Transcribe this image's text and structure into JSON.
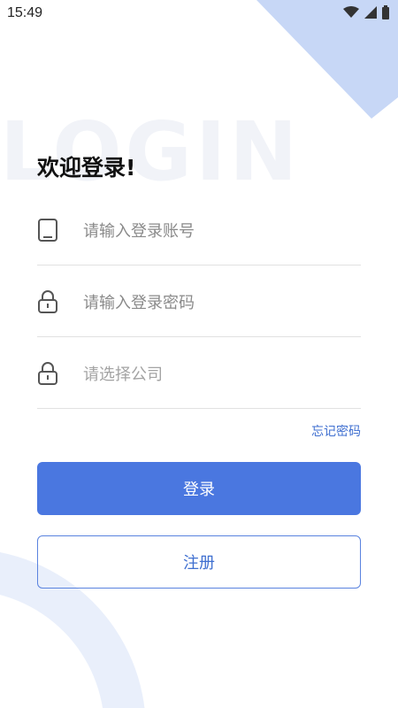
{
  "status_bar": {
    "time": "15:49",
    "icons": [
      "wifi-icon",
      "signal-icon",
      "battery-icon"
    ]
  },
  "watermark": "LOGIN",
  "welcome_title": "欢迎登录!",
  "form": {
    "account_placeholder": "请输入登录账号",
    "password_placeholder": "请输入登录密码",
    "company_placeholder": "请选择公司"
  },
  "forgot_password": "忘记密码",
  "login_button": "登录",
  "register_button": "注册",
  "colors": {
    "primary": "#4a77e0",
    "link": "#3f6fd0",
    "deco_blue": "#c7d7f6",
    "deco_light": "#e9effb"
  }
}
